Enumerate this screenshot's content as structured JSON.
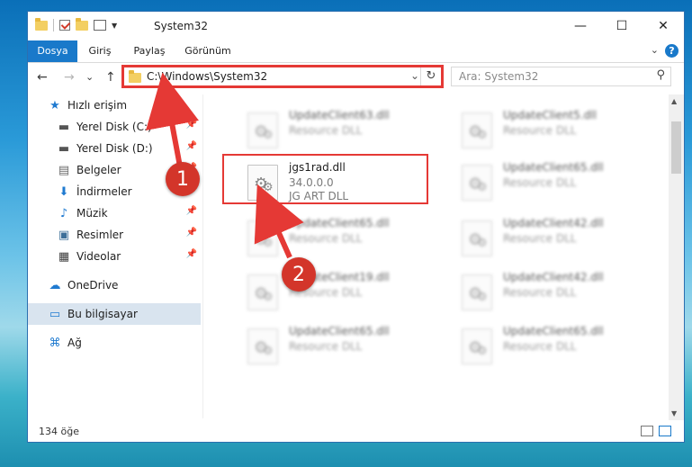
{
  "window": {
    "title": "System32",
    "minimize": "—",
    "maximize": "☐",
    "close": "✕"
  },
  "ribbon": {
    "tabs": [
      "Dosya",
      "Giriş",
      "Paylaş",
      "Görünüm"
    ],
    "chevron": "⌄",
    "help": "?"
  },
  "nav": {
    "back": "←",
    "forward": "→",
    "recent": "⌄",
    "up": "↑"
  },
  "address": {
    "path": "C:\\Windows\\System32",
    "dropdown": "⌄",
    "refresh": "↻"
  },
  "search": {
    "placeholder": "Ara: System32",
    "icon": "⚲"
  },
  "sidebar": {
    "items": [
      {
        "label": "Hızlı erişim",
        "icon": "star-icon",
        "glyph": "★",
        "color": "#1f7ad0",
        "pinned": false
      },
      {
        "label": "Yerel Disk (C:)",
        "icon": "drive-icon",
        "glyph": "▬",
        "color": "#555555",
        "pinned": true
      },
      {
        "label": "Yerel Disk (D:)",
        "icon": "drive-icon",
        "glyph": "▬",
        "color": "#555555",
        "pinned": true
      },
      {
        "label": "Belgeler",
        "icon": "documents-icon",
        "glyph": "▤",
        "color": "#6a6a6a",
        "pinned": true
      },
      {
        "label": "İndirmeler",
        "icon": "download-icon",
        "glyph": "⬇",
        "color": "#1f7ad0",
        "pinned": true
      },
      {
        "label": "Müzik",
        "icon": "music-icon",
        "glyph": "♪",
        "color": "#1f7ad0",
        "pinned": true
      },
      {
        "label": "Resimler",
        "icon": "pictures-icon",
        "glyph": "▣",
        "color": "#3d6f99",
        "pinned": true
      },
      {
        "label": "Videolar",
        "icon": "videos-icon",
        "glyph": "▦",
        "color": "#3a3a3a",
        "pinned": true
      },
      {
        "label": "OneDrive",
        "icon": "cloud-icon",
        "glyph": "☁",
        "color": "#1f7ad0",
        "pinned": false
      },
      {
        "label": "Bu bilgisayar",
        "icon": "computer-icon",
        "glyph": "▭",
        "color": "#1f7ad0",
        "pinned": false
      },
      {
        "label": "Ağ",
        "icon": "network-icon",
        "glyph": "⌘",
        "color": "#1f7ad0",
        "pinned": false
      }
    ],
    "pin_glyph": "📌"
  },
  "files": {
    "left": [
      {
        "name": "UpdateClient63.dll",
        "type": "Resource DLL"
      },
      {
        "name": "jgs1rad.dll",
        "version": "34.0.0.0",
        "type": "JG ART DLL",
        "highlighted": true
      },
      {
        "name": "UpdateClient65.dll",
        "type": "Resource DLL"
      },
      {
        "name": "UpdateClient19.dll",
        "type": "Resource DLL"
      },
      {
        "name": "UpdateClient65.dll",
        "type": "Resource DLL"
      }
    ],
    "right": [
      {
        "name": "UpdateClient5.dll",
        "type": "Resource DLL"
      },
      {
        "name": "UpdateClient65.dll",
        "type": "Resource DLL"
      },
      {
        "name": "UpdateClient42.dll",
        "type": "Resource DLL"
      },
      {
        "name": "UpdateClient42.dll",
        "type": "Resource DLL"
      },
      {
        "name": "UpdateClient65.dll",
        "type": "Resource DLL"
      }
    ]
  },
  "status": {
    "count": "134 öğe"
  },
  "annotations": {
    "step1": "1",
    "step2": "2",
    "accent": "#e53935"
  }
}
